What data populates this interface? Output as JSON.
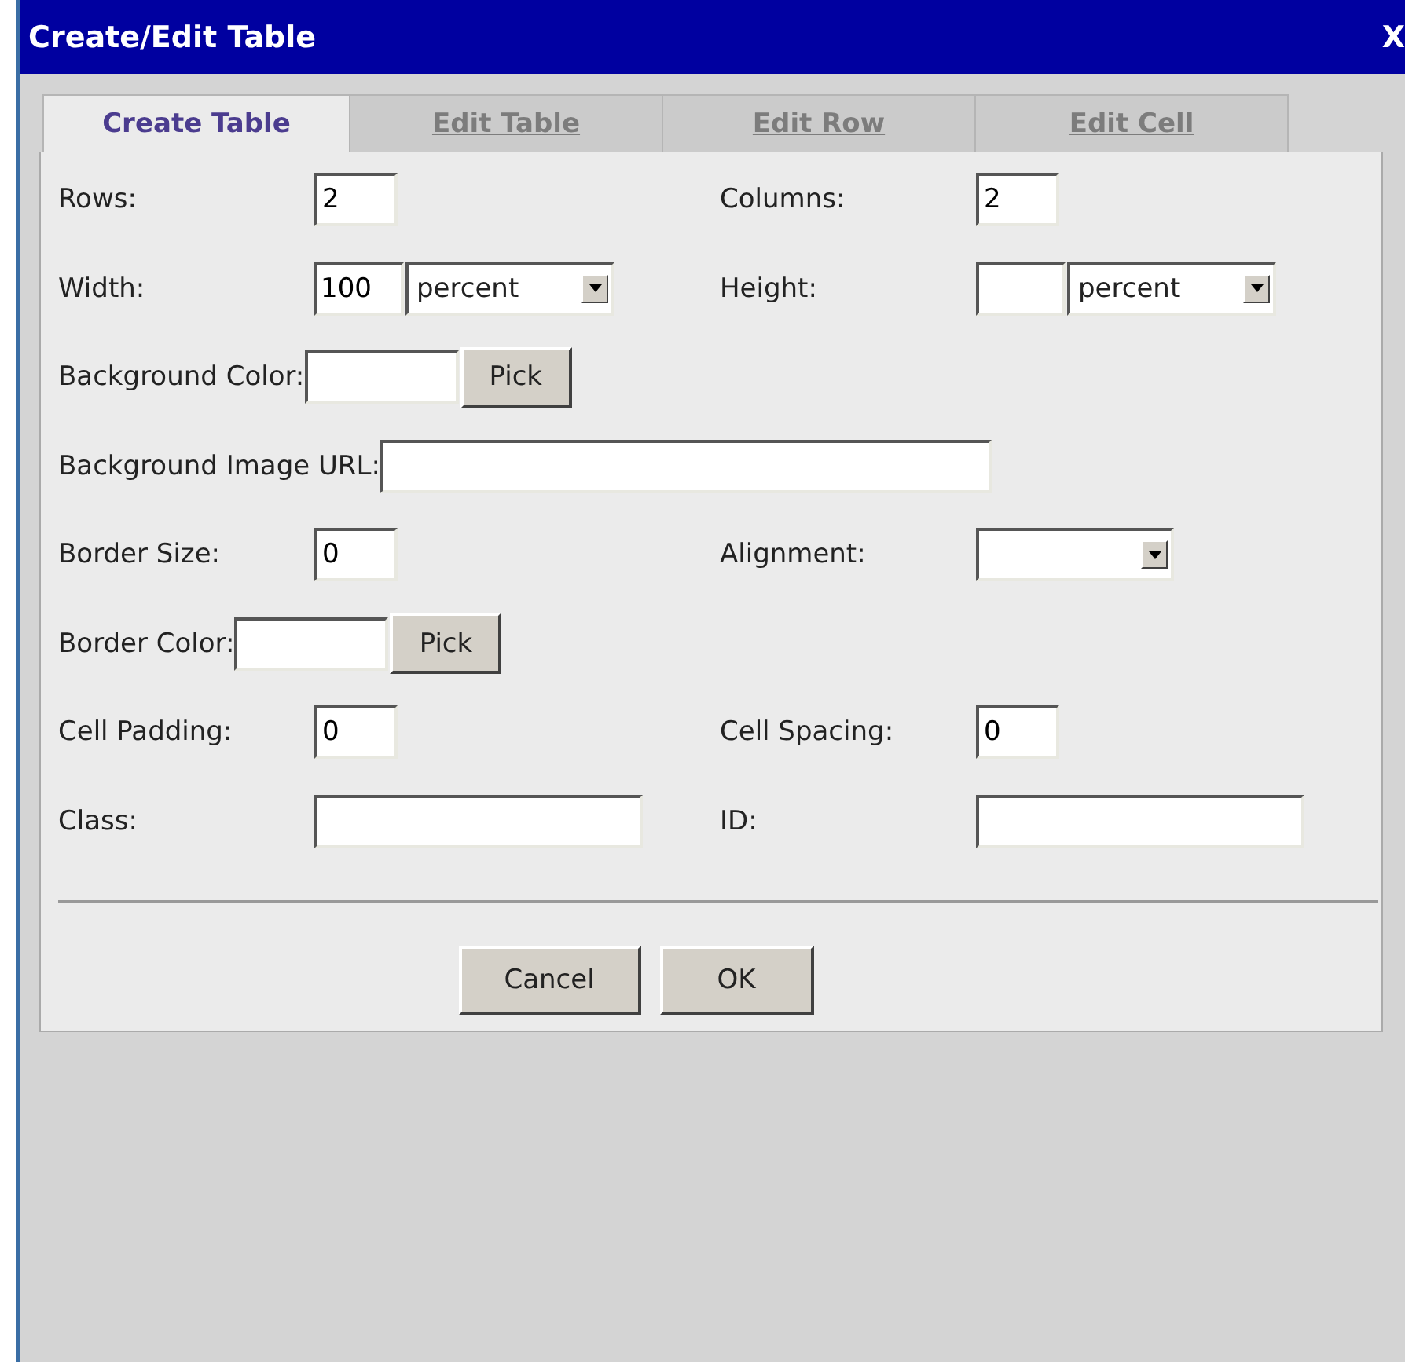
{
  "window": {
    "title": "Create/Edit Table",
    "close": "X"
  },
  "tabs": [
    {
      "label": "Create Table",
      "selected": true,
      "disabled": false
    },
    {
      "label": "Edit Table",
      "selected": false,
      "disabled": true
    },
    {
      "label": "Edit Row",
      "selected": false,
      "disabled": true
    },
    {
      "label": "Edit Cell",
      "selected": false,
      "disabled": true
    }
  ],
  "rows": [
    [
      {
        "kind": "short",
        "label": "Rows:",
        "value": "2"
      },
      {
        "kind": "short",
        "label": "Columns:",
        "value": "2"
      }
    ],
    [
      {
        "kind": "dimension",
        "label": "Width:",
        "value": "100",
        "unit": "percent"
      },
      {
        "kind": "dimension",
        "label": "Height:",
        "unit": "percent"
      }
    ],
    [
      {
        "kind": "color",
        "label": "Background Color:",
        "button": "Pick"
      }
    ],
    [
      {
        "kind": "url",
        "label": "Background Image URL:"
      }
    ],
    [
      {
        "kind": "short",
        "label": "Border Size:",
        "value": "0"
      },
      {
        "kind": "select",
        "label": "Alignment:"
      }
    ],
    [
      {
        "kind": "color",
        "label": "Border Color:",
        "button": "Pick"
      }
    ],
    [
      {
        "kind": "short",
        "label": "Cell Padding:",
        "value": "0"
      },
      {
        "kind": "short",
        "label": "Cell Spacing:",
        "value": "0"
      }
    ],
    [
      {
        "kind": "text",
        "label": "Class:"
      },
      {
        "kind": "text",
        "label": "ID:"
      }
    ]
  ],
  "buttons": [
    "Cancel",
    "OK"
  ]
}
